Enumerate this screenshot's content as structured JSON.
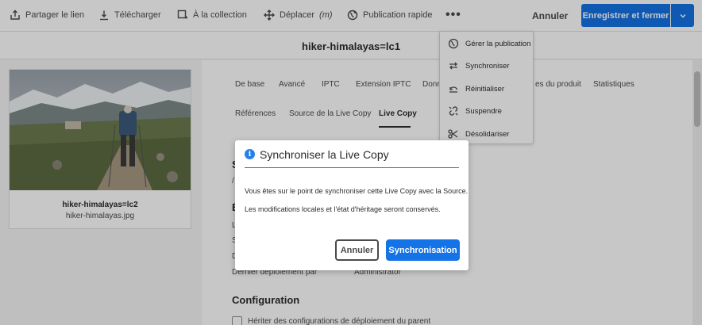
{
  "toolbar": {
    "share_link": "Partager le lien",
    "download": "Télécharger",
    "to_collection": "À la collection",
    "move": "Déplacer",
    "move_shortcut": "(m)",
    "quick_publish": "Publication rapide",
    "more": "•••",
    "cancel": "Annuler",
    "save_close": "Enregistrer et fermer"
  },
  "page": {
    "title": "hiker-himalayas=lc1"
  },
  "card": {
    "name": "hiker-himalayas=lc2",
    "file": "hiker-himalayas.jpg"
  },
  "tabs": {
    "row1": [
      "De base",
      "Avancé",
      "IPTC",
      "Extension IPTC",
      "Donn",
      "es du produit",
      "Statistiques"
    ],
    "row2": [
      "Références",
      "Source de la Live Copy",
      "Live Copy"
    ],
    "active": "Live Copy"
  },
  "fields": {
    "partial_s": "S",
    "partial_slash": "/",
    "partial_e": "É",
    "partial_l": "L",
    "partial_s2": "S",
    "partial_d": "D",
    "last_rollout_label": "Dernier déploiement par",
    "last_rollout_value": "Administrator"
  },
  "configuration": {
    "heading": "Configuration",
    "inherit_label": "Hériter des configurations de déploiement du parent"
  },
  "menu": {
    "items": [
      "Gérer la publication",
      "Synchroniser",
      "Réinitialiser",
      "Suspendre",
      "Désolidariser"
    ]
  },
  "dialog": {
    "icon": "i",
    "title": "Synchroniser la Live Copy",
    "line1": "Vous êtes sur le point de synchroniser cette Live Copy avec la Source.",
    "line2": "Les modifications locales et l'état d'héritage seront conservés.",
    "cancel": "Annuler",
    "confirm": "Synchronisation"
  },
  "colors": {
    "accent": "#1473e6",
    "info": "#2680eb"
  }
}
